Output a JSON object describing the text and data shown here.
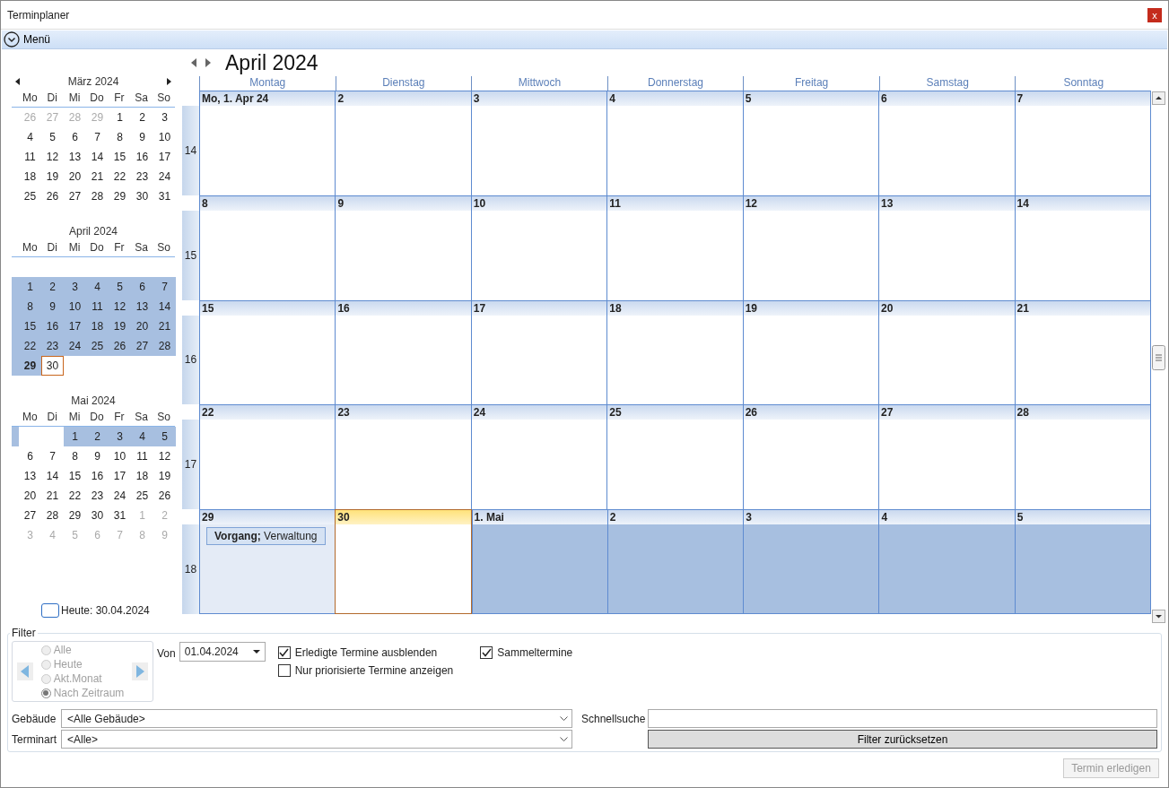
{
  "window": {
    "title": "Terminplaner",
    "close": "x"
  },
  "menu": {
    "label": "Menü"
  },
  "mini_calendars": [
    {
      "title": "März 2024",
      "nav": true,
      "blank_first_row": false,
      "weekdays": [
        "Mo",
        "Di",
        "Mi",
        "Do",
        "Fr",
        "Sa",
        "So"
      ],
      "weeks": [
        {
          "marked": false,
          "days": [
            {
              "label": "26",
              "kind": "muted",
              "selected": false
            },
            {
              "label": "27",
              "kind": "muted",
              "selected": false
            },
            {
              "label": "28",
              "kind": "muted",
              "selected": false
            },
            {
              "label": "29",
              "kind": "muted",
              "selected": false
            },
            {
              "label": "1",
              "kind": "normal",
              "selected": false
            },
            {
              "label": "2",
              "kind": "normal",
              "selected": false
            },
            {
              "label": "3",
              "kind": "normal",
              "selected": false
            }
          ]
        },
        {
          "marked": false,
          "days": [
            {
              "label": "4",
              "kind": "normal",
              "selected": false
            },
            {
              "label": "5",
              "kind": "normal",
              "selected": false
            },
            {
              "label": "6",
              "kind": "normal",
              "selected": false
            },
            {
              "label": "7",
              "kind": "normal",
              "selected": false
            },
            {
              "label": "8",
              "kind": "normal",
              "selected": false
            },
            {
              "label": "9",
              "kind": "normal",
              "selected": false
            },
            {
              "label": "10",
              "kind": "normal",
              "selected": false
            }
          ]
        },
        {
          "marked": false,
          "days": [
            {
              "label": "11",
              "kind": "normal",
              "selected": false
            },
            {
              "label": "12",
              "kind": "normal",
              "selected": false
            },
            {
              "label": "13",
              "kind": "normal",
              "selected": false
            },
            {
              "label": "14",
              "kind": "normal",
              "selected": false
            },
            {
              "label": "15",
              "kind": "normal",
              "selected": false
            },
            {
              "label": "16",
              "kind": "normal",
              "selected": false
            },
            {
              "label": "17",
              "kind": "normal",
              "selected": false
            }
          ]
        },
        {
          "marked": false,
          "days": [
            {
              "label": "18",
              "kind": "normal",
              "selected": false
            },
            {
              "label": "19",
              "kind": "normal",
              "selected": false
            },
            {
              "label": "20",
              "kind": "normal",
              "selected": false
            },
            {
              "label": "21",
              "kind": "normal",
              "selected": false
            },
            {
              "label": "22",
              "kind": "normal",
              "selected": false
            },
            {
              "label": "23",
              "kind": "normal",
              "selected": false
            },
            {
              "label": "24",
              "kind": "normal",
              "selected": false
            }
          ]
        },
        {
          "marked": false,
          "days": [
            {
              "label": "25",
              "kind": "normal",
              "selected": false
            },
            {
              "label": "26",
              "kind": "normal",
              "selected": false
            },
            {
              "label": "27",
              "kind": "normal",
              "selected": false
            },
            {
              "label": "28",
              "kind": "normal",
              "selected": false
            },
            {
              "label": "29",
              "kind": "normal",
              "selected": false
            },
            {
              "label": "30",
              "kind": "normal",
              "selected": false
            },
            {
              "label": "31",
              "kind": "normal",
              "selected": false
            }
          ]
        }
      ]
    },
    {
      "title": "April 2024",
      "nav": false,
      "blank_first_row": true,
      "weekdays": [
        "Mo",
        "Di",
        "Mi",
        "Do",
        "Fr",
        "Sa",
        "So"
      ],
      "weeks": [
        {
          "marked": true,
          "days": [
            {
              "label": "1",
              "kind": "normal",
              "selected": true
            },
            {
              "label": "2",
              "kind": "normal",
              "selected": true
            },
            {
              "label": "3",
              "kind": "normal",
              "selected": true
            },
            {
              "label": "4",
              "kind": "normal",
              "selected": true
            },
            {
              "label": "5",
              "kind": "normal",
              "selected": true
            },
            {
              "label": "6",
              "kind": "normal",
              "selected": true
            },
            {
              "label": "7",
              "kind": "normal",
              "selected": true
            }
          ]
        },
        {
          "marked": true,
          "days": [
            {
              "label": "8",
              "kind": "normal",
              "selected": true
            },
            {
              "label": "9",
              "kind": "normal",
              "selected": true
            },
            {
              "label": "10",
              "kind": "normal",
              "selected": true
            },
            {
              "label": "11",
              "kind": "normal",
              "selected": true
            },
            {
              "label": "12",
              "kind": "normal",
              "selected": true
            },
            {
              "label": "13",
              "kind": "normal",
              "selected": true
            },
            {
              "label": "14",
              "kind": "normal",
              "selected": true
            }
          ]
        },
        {
          "marked": true,
          "days": [
            {
              "label": "15",
              "kind": "normal",
              "selected": true
            },
            {
              "label": "16",
              "kind": "normal",
              "selected": true
            },
            {
              "label": "17",
              "kind": "normal",
              "selected": true
            },
            {
              "label": "18",
              "kind": "normal",
              "selected": true
            },
            {
              "label": "19",
              "kind": "normal",
              "selected": true
            },
            {
              "label": "20",
              "kind": "normal",
              "selected": true
            },
            {
              "label": "21",
              "kind": "normal",
              "selected": true
            }
          ]
        },
        {
          "marked": true,
          "days": [
            {
              "label": "22",
              "kind": "normal",
              "selected": true
            },
            {
              "label": "23",
              "kind": "normal",
              "selected": true
            },
            {
              "label": "24",
              "kind": "normal",
              "selected": true
            },
            {
              "label": "25",
              "kind": "normal",
              "selected": true
            },
            {
              "label": "26",
              "kind": "normal",
              "selected": true
            },
            {
              "label": "27",
              "kind": "normal",
              "selected": true
            },
            {
              "label": "28",
              "kind": "normal",
              "selected": true
            }
          ]
        },
        {
          "marked": true,
          "days": [
            {
              "label": "29",
              "kind": "bold",
              "selected": true
            },
            {
              "label": "30",
              "kind": "today",
              "selected": false
            }
          ]
        }
      ]
    },
    {
      "title": "Mai 2024",
      "nav": false,
      "blank_first_row": false,
      "weekdays": [
        "Mo",
        "Di",
        "Mi",
        "Do",
        "Fr",
        "Sa",
        "So"
      ],
      "weeks": [
        {
          "marked": true,
          "days": [
            {
              "kind": "empty",
              "selected": false
            },
            {
              "kind": "empty",
              "selected": false
            },
            {
              "label": "1",
              "kind": "normal",
              "selected": true
            },
            {
              "label": "2",
              "kind": "normal",
              "selected": true
            },
            {
              "label": "3",
              "kind": "normal",
              "selected": true
            },
            {
              "label": "4",
              "kind": "normal",
              "selected": true
            },
            {
              "label": "5",
              "kind": "normal",
              "selected": true
            }
          ]
        },
        {
          "marked": false,
          "days": [
            {
              "label": "6",
              "kind": "normal",
              "selected": false
            },
            {
              "label": "7",
              "kind": "normal",
              "selected": false
            },
            {
              "label": "8",
              "kind": "normal",
              "selected": false
            },
            {
              "label": "9",
              "kind": "normal",
              "selected": false
            },
            {
              "label": "10",
              "kind": "normal",
              "selected": false
            },
            {
              "label": "11",
              "kind": "normal",
              "selected": false
            },
            {
              "label": "12",
              "kind": "normal",
              "selected": false
            }
          ]
        },
        {
          "marked": false,
          "days": [
            {
              "label": "13",
              "kind": "normal",
              "selected": false
            },
            {
              "label": "14",
              "kind": "normal",
              "selected": false
            },
            {
              "label": "15",
              "kind": "normal",
              "selected": false
            },
            {
              "label": "16",
              "kind": "normal",
              "selected": false
            },
            {
              "label": "17",
              "kind": "normal",
              "selected": false
            },
            {
              "label": "18",
              "kind": "normal",
              "selected": false
            },
            {
              "label": "19",
              "kind": "normal",
              "selected": false
            }
          ]
        },
        {
          "marked": false,
          "days": [
            {
              "label": "20",
              "kind": "normal",
              "selected": false
            },
            {
              "label": "21",
              "kind": "normal",
              "selected": false
            },
            {
              "label": "22",
              "kind": "normal",
              "selected": false
            },
            {
              "label": "23",
              "kind": "normal",
              "selected": false
            },
            {
              "label": "24",
              "kind": "normal",
              "selected": false
            },
            {
              "label": "25",
              "kind": "normal",
              "selected": false
            },
            {
              "label": "26",
              "kind": "normal",
              "selected": false
            }
          ]
        },
        {
          "marked": false,
          "days": [
            {
              "label": "27",
              "kind": "normal",
              "selected": false
            },
            {
              "label": "28",
              "kind": "normal",
              "selected": false
            },
            {
              "label": "29",
              "kind": "normal",
              "selected": false
            },
            {
              "label": "30",
              "kind": "normal",
              "selected": false
            },
            {
              "label": "31",
              "kind": "normal",
              "selected": false
            },
            {
              "label": "1",
              "kind": "muted",
              "selected": false
            },
            {
              "label": "2",
              "kind": "muted",
              "selected": false
            }
          ]
        },
        {
          "marked": false,
          "days": [
            {
              "label": "3",
              "kind": "muted",
              "selected": false
            },
            {
              "label": "4",
              "kind": "muted",
              "selected": false
            },
            {
              "label": "5",
              "kind": "muted",
              "selected": false
            },
            {
              "label": "6",
              "kind": "muted",
              "selected": false
            },
            {
              "label": "7",
              "kind": "muted",
              "selected": false
            },
            {
              "label": "8",
              "kind": "muted",
              "selected": false
            },
            {
              "label": "9",
              "kind": "muted",
              "selected": false
            }
          ]
        }
      ]
    }
  ],
  "today_button": {
    "label": "Heute: 30.04.2024"
  },
  "calendar": {
    "title": "April 2024",
    "weekdays": [
      "Montag",
      "Dienstag",
      "Mittwoch",
      "Donnerstag",
      "Freitag",
      "Samstag",
      "Sonntag"
    ],
    "weeks": [
      {
        "number": "14",
        "days": [
          {
            "label": "Mo, 1. Apr 24",
            "selected": false,
            "other_month": false,
            "today": false
          },
          {
            "label": "2",
            "selected": false,
            "other_month": false,
            "today": false
          },
          {
            "label": "3",
            "selected": false,
            "other_month": false,
            "today": false
          },
          {
            "label": "4",
            "selected": false,
            "other_month": false,
            "today": false
          },
          {
            "label": "5",
            "selected": false,
            "other_month": false,
            "today": false
          },
          {
            "label": "6",
            "selected": false,
            "other_month": false,
            "today": false
          },
          {
            "label": "7",
            "selected": false,
            "other_month": false,
            "today": false
          }
        ]
      },
      {
        "number": "15",
        "days": [
          {
            "label": "8",
            "selected": false,
            "other_month": false,
            "today": false
          },
          {
            "label": "9",
            "selected": false,
            "other_month": false,
            "today": false
          },
          {
            "label": "10",
            "selected": false,
            "other_month": false,
            "today": false
          },
          {
            "label": "11",
            "selected": false,
            "other_month": false,
            "today": false
          },
          {
            "label": "12",
            "selected": false,
            "other_month": false,
            "today": false
          },
          {
            "label": "13",
            "selected": false,
            "other_month": false,
            "today": false
          },
          {
            "label": "14",
            "selected": false,
            "other_month": false,
            "today": false
          }
        ]
      },
      {
        "number": "16",
        "days": [
          {
            "label": "15",
            "selected": false,
            "other_month": false,
            "today": false
          },
          {
            "label": "16",
            "selected": false,
            "other_month": false,
            "today": false
          },
          {
            "label": "17",
            "selected": false,
            "other_month": false,
            "today": false
          },
          {
            "label": "18",
            "selected": false,
            "other_month": false,
            "today": false
          },
          {
            "label": "19",
            "selected": false,
            "other_month": false,
            "today": false
          },
          {
            "label": "20",
            "selected": false,
            "other_month": false,
            "today": false
          },
          {
            "label": "21",
            "selected": false,
            "other_month": false,
            "today": false
          }
        ]
      },
      {
        "number": "17",
        "days": [
          {
            "label": "22",
            "selected": false,
            "other_month": false,
            "today": false
          },
          {
            "label": "23",
            "selected": false,
            "other_month": false,
            "today": false
          },
          {
            "label": "24",
            "selected": false,
            "other_month": false,
            "today": false
          },
          {
            "label": "25",
            "selected": false,
            "other_month": false,
            "today": false
          },
          {
            "label": "26",
            "selected": false,
            "other_month": false,
            "today": false
          },
          {
            "label": "27",
            "selected": false,
            "other_month": false,
            "today": false
          },
          {
            "label": "28",
            "selected": false,
            "other_month": false,
            "today": false
          }
        ]
      },
      {
        "number": "18",
        "days": [
          {
            "label": "29",
            "selected": true,
            "other_month": false,
            "today": false,
            "events": [
              "**Vorgang;** Verwaltung"
            ]
          },
          {
            "label": "30",
            "selected": false,
            "other_month": false,
            "today": true
          },
          {
            "label": "1. Mai",
            "selected": false,
            "other_month": true,
            "today": false
          },
          {
            "label": "2",
            "selected": false,
            "other_month": true,
            "today": false
          },
          {
            "label": "3",
            "selected": false,
            "other_month": true,
            "today": false
          },
          {
            "label": "4",
            "selected": false,
            "other_month": true,
            "today": false
          },
          {
            "label": "5",
            "selected": false,
            "other_month": true,
            "today": false
          }
        ]
      }
    ]
  },
  "filter": {
    "title": "Filter",
    "range_options": [
      {
        "label": "Alle",
        "selected": false,
        "disabled": true
      },
      {
        "label": "Heute",
        "selected": false,
        "disabled": true
      },
      {
        "label": "Akt.Monat",
        "selected": false,
        "disabled": true
      },
      {
        "label": "Nach Zeitraum",
        "selected": true,
        "disabled": true
      }
    ],
    "from_label": "Von",
    "from_value": "01.04.2024",
    "checkboxes": [
      {
        "label": "Erledigte Termine ausblenden",
        "checked": true
      },
      {
        "label": "Nur priorisierte Termine anzeigen",
        "checked": false
      },
      {
        "label": "Sammeltermine",
        "checked": true
      }
    ],
    "building_label": "Gebäude",
    "building_value": "<Alle Gebäude>",
    "type_label": "Terminart",
    "type_value": "<Alle>",
    "search_label": "Schnellsuche",
    "reset_button": "Filter zurücksetzen"
  },
  "complete_button": {
    "label": "Termin erledigen",
    "disabled": true
  }
}
